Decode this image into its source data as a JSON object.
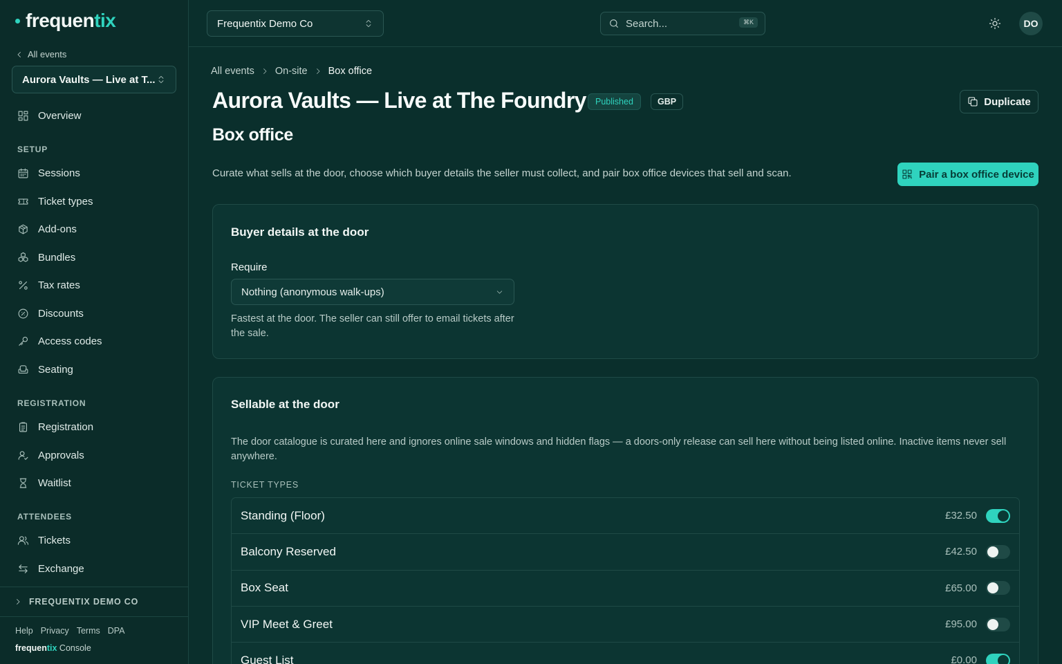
{
  "brand": {
    "name_main": "frequen",
    "name_accent": "tix",
    "console_label": "Console"
  },
  "sidebar": {
    "back_label": "All events",
    "event_picker": "Aurora Vaults — Live at T...",
    "overview": "Overview",
    "sections": {
      "setup": "SETUP",
      "registration": "REGISTRATION",
      "attendees": "ATTENDEES"
    },
    "setup_items": [
      "Sessions",
      "Ticket types",
      "Add-ons",
      "Bundles",
      "Tax rates",
      "Discounts",
      "Access codes",
      "Seating"
    ],
    "registration_items": [
      "Registration",
      "Approvals",
      "Waitlist"
    ],
    "attendee_items": [
      "Tickets",
      "Exchange"
    ],
    "org_label": "FREQUENTIX DEMO CO",
    "footer_links": [
      "Help",
      "Privacy",
      "Terms",
      "DPA"
    ]
  },
  "topbar": {
    "org_select": "Frequentix Demo Co",
    "search_placeholder": "Search...",
    "search_shortcut": "⌘K",
    "avatar_initials": "DO"
  },
  "breadcrumb": [
    "All events",
    "On-site",
    "Box office"
  ],
  "page": {
    "title": "Aurora Vaults — Live at The Foundry",
    "status_badge": "Published",
    "currency_badge": "GBP",
    "duplicate_label": "Duplicate",
    "section_title": "Box office",
    "intro": "Curate what sells at the door, choose which buyer details the seller must collect, and pair box office devices that sell and scan.",
    "pair_button": "Pair a box office device"
  },
  "buyer_details": {
    "title": "Buyer details at the door",
    "require_label": "Require",
    "require_value": "Nothing (anonymous walk-ups)",
    "helper": "Fastest at the door. The seller can still offer to email tickets after the sale."
  },
  "sellable": {
    "title": "Sellable at the door",
    "description": "The door catalogue is curated here and ignores online sale windows and hidden flags — a doors-only release can sell here without being listed online. Inactive items never sell anywhere.",
    "ticket_types_heading": "TICKET TYPES",
    "tickets": [
      {
        "name": "Standing (Floor)",
        "price": "£32.50",
        "enabled": true
      },
      {
        "name": "Balcony Reserved",
        "price": "£42.50",
        "enabled": false
      },
      {
        "name": "Box Seat",
        "price": "£65.00",
        "enabled": false
      },
      {
        "name": "VIP Meet & Greet",
        "price": "£95.00",
        "enabled": false
      },
      {
        "name": "Guest List",
        "price": "£0.00",
        "enabled": true
      }
    ]
  },
  "colors": {
    "accent": "#2fd3be",
    "background": "#0a2f2c"
  }
}
